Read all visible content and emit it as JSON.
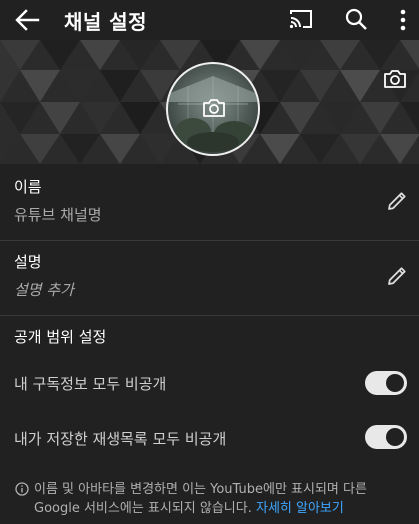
{
  "header": {
    "title": "채널 설정",
    "icons": [
      "back-arrow-icon",
      "cast-icon",
      "search-icon",
      "more-vert-icon"
    ]
  },
  "banner": {
    "icons": [
      "camera-icon",
      "camera-icon"
    ]
  },
  "name_section": {
    "label": "이름",
    "value": "유튜브 채널명"
  },
  "description_section": {
    "label": "설명",
    "placeholder": "설명 추가"
  },
  "privacy": {
    "title": "공개 범위 설정",
    "subscriptions_label": "내 구독정보 모두 비공개",
    "subscriptions_on": true,
    "playlists_label": "내가 저장한 재생목록 모두 비공개",
    "playlists_on": true
  },
  "footer": {
    "text": "이름 및 아바타를 변경하면 이는 YouTube에만 표시되며 다른 Google 서비스에는 표시되지 않습니다.",
    "link_text": "자세히 알아보기"
  },
  "colors": {
    "background": "#212121",
    "link": "#3ea6ff",
    "toggle_on": "#e8e8e8"
  }
}
